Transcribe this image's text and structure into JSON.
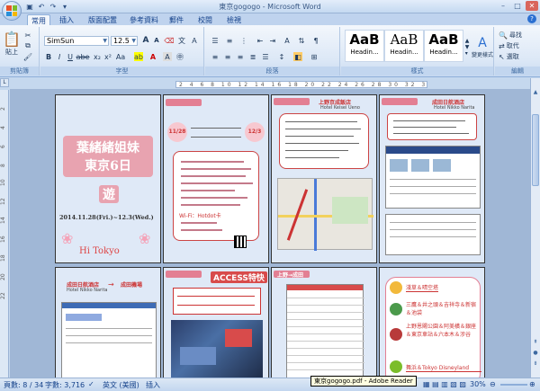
{
  "window": {
    "title": "東京gogogo - Microsoft Word",
    "qat_icons": [
      "save-icon",
      "undo-icon",
      "redo-icon"
    ],
    "controls": [
      "–",
      "□",
      "✕"
    ]
  },
  "tabs": [
    "常用",
    "插入",
    "版面配置",
    "參考資料",
    "郵件",
    "校閱",
    "檢視"
  ],
  "active_tab": "常用",
  "ribbon": {
    "clipboard": {
      "label": "剪貼簿",
      "paste_label": "貼上"
    },
    "font": {
      "label": "字型",
      "font_name": "SimSun",
      "font_size": "12.5"
    },
    "paragraph": {
      "label": "段落"
    },
    "styles": {
      "label": "樣式",
      "items": [
        {
          "sample": "AaB",
          "name": "Headin..."
        },
        {
          "sample": "AaB",
          "name": "Headin..."
        },
        {
          "sample": "AaB",
          "name": "Headin..."
        }
      ],
      "change_label": "變更樣式"
    },
    "editing": {
      "label": "編輯",
      "find": "尋找",
      "replace": "取代",
      "select": "選取"
    }
  },
  "ruler": {
    "marks": "2 4 6 8 10 12 14 16 18 20 22 24 26 28 30 32 34 36 38 40 42 44"
  },
  "vruler": {
    "marks": [
      "2",
      "4",
      "6",
      "8",
      "10",
      "12",
      "14",
      "16",
      "18",
      "20",
      "22"
    ]
  },
  "pages": {
    "p1": {
      "title_line1": "葉緒緒姐妹",
      "title_line2": "東京6日",
      "title_line3": "遊",
      "dates": "2014.11.28(Fri.)~12.3(Wed.)",
      "hi": "Hi  Tokyo"
    },
    "p2": {
      "date_left": "11/28",
      "date_right": "12/3",
      "wifi": "Wi-Fi：Hotdot卡",
      "content": "生活必需品…"
    },
    "p3": {
      "header": "上野京成飯店",
      "hotel_en": "Hotel Keisei Ueno"
    },
    "p4": {
      "header": "成田日航酒店",
      "hotel_en": "Hotel Nikko Narita"
    },
    "p5": {
      "left": "成田日航酒店",
      "left_en": "Hotel Nikko Narita",
      "right": "成田機場"
    },
    "p6": {
      "banner": "ACCESS特快",
      "header": "上野→成田"
    },
    "p7": {
      "header": "上野→成田"
    },
    "p8": {
      "items": [
        "淺草＆晴空塔",
        "三鷹＆井之頭＆吉祥寺＆新宿＆池袋",
        "上野恩賜公園＆阿美橫＆銀座＆東京車站＆六本木＆涉谷",
        "舞浜＆Tokyo Disneyland"
      ]
    }
  },
  "status": {
    "page": "頁數: 8 / 34",
    "words": "字數: 3,716",
    "lang": "英文 (美國)",
    "mode": "插入",
    "zoom": "30%",
    "tooltip": "東京gogogo.pdf - Adobe Reader"
  },
  "colors": {
    "ribbon_bg": "#dbe7f6",
    "title_pink": "#e06b7a",
    "doc_bg": "#a0b7d6",
    "accent_blue": "#15428b"
  }
}
